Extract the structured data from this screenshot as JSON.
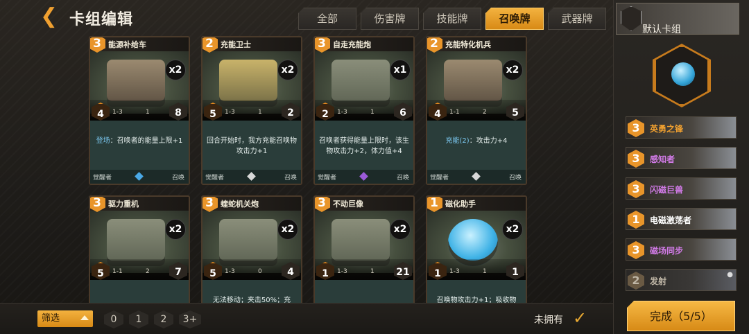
{
  "header": {
    "title": "卡组编辑",
    "tabs": [
      "全部",
      "伤害牌",
      "技能牌",
      "召唤牌",
      "武器牌"
    ],
    "active_tab": "召唤牌"
  },
  "cards": [
    {
      "name": "能源补给车",
      "cost": "3",
      "count": "x2",
      "atk": "4",
      "range": "1-3",
      "mid": "1",
      "hp": "8",
      "desc_kw": "登场",
      "desc": "：召唤者的能量上限+1",
      "foot_left": "觉醒者",
      "foot_right": "召唤",
      "gem": "#4aa8e6"
    },
    {
      "name": "充能卫士",
      "cost": "2",
      "count": "x2",
      "atk": "5",
      "range": "1-3",
      "mid": "1",
      "hp": "2",
      "desc_kw": "",
      "desc": "回合开始时，我方充能召唤物攻击力+1",
      "foot_left": "觉醒者",
      "foot_right": "召唤",
      "gem": "#d8d8d8"
    },
    {
      "name": "自走充能炮",
      "cost": "3",
      "count": "x1",
      "atk": "2",
      "range": "1-3",
      "mid": "1",
      "hp": "6",
      "desc_kw": "",
      "desc": "召唤者获得能量上限时，该生物攻击力+2，体力值+4",
      "foot_left": "觉醒者",
      "foot_right": "召唤",
      "gem": "#9a5ad8"
    },
    {
      "name": "充能特化机兵",
      "cost": "2",
      "count": "x2",
      "atk": "4",
      "range": "1-1",
      "mid": "2",
      "hp": "5",
      "desc_kw": "充能(2)",
      "desc": "：攻击力+4",
      "foot_left": "觉醒者",
      "foot_right": "召唤",
      "gem": "#d8d8d8"
    },
    {
      "name": "驱力重机",
      "cost": "3",
      "count": "x2",
      "atk": "5",
      "range": "1-1",
      "mid": "2",
      "hp": "7",
      "desc_kw": "",
      "desc": "",
      "foot_left": "",
      "foot_right": "",
      "gem": ""
    },
    {
      "name": "蝰蛇机关炮",
      "cost": "3",
      "count": "x2",
      "atk": "5",
      "range": "1-3",
      "mid": "0",
      "hp": "4",
      "desc_kw": "",
      "desc": "无法移动；夹击50%；充",
      "foot_left": "",
      "foot_right": "",
      "gem": ""
    },
    {
      "name": "不动巨像",
      "cost": "3",
      "count": "x2",
      "atk": "1",
      "range": "1-3",
      "mid": "1",
      "hp": "21",
      "desc_kw": "",
      "desc": "",
      "foot_left": "",
      "foot_right": "",
      "gem": ""
    },
    {
      "name": "磁化助手",
      "cost": "1",
      "count": "x2",
      "atk": "1",
      "range": "1-3",
      "mid": "1",
      "hp": "1",
      "desc_kw": "",
      "desc": "召唤物攻击力+1；吸收物",
      "foot_left": "",
      "foot_right": "",
      "gem": ""
    }
  ],
  "bottom": {
    "filter_label": "筛选",
    "cost_filters": [
      "0",
      "1",
      "2",
      "3+"
    ],
    "not_owned_label": "未拥有"
  },
  "deck": {
    "name": "默认卡组",
    "items": [
      {
        "cost": "3",
        "name": "英勇之锋",
        "color": "#f0a030",
        "locked": false
      },
      {
        "cost": "3",
        "name": "感知者",
        "color": "#d27be8",
        "locked": false
      },
      {
        "cost": "3",
        "name": "闪磁巨兽",
        "color": "#d27be8",
        "locked": false
      },
      {
        "cost": "1",
        "name": "电磁激荡者",
        "color": "#ffffff",
        "locked": false
      },
      {
        "cost": "3",
        "name": "磁场同步",
        "color": "#d27be8",
        "locked": false
      },
      {
        "cost": "2",
        "name": "发射",
        "color": "#bfb6a6",
        "locked": true
      }
    ],
    "finish_label": "完成（5/5）"
  }
}
